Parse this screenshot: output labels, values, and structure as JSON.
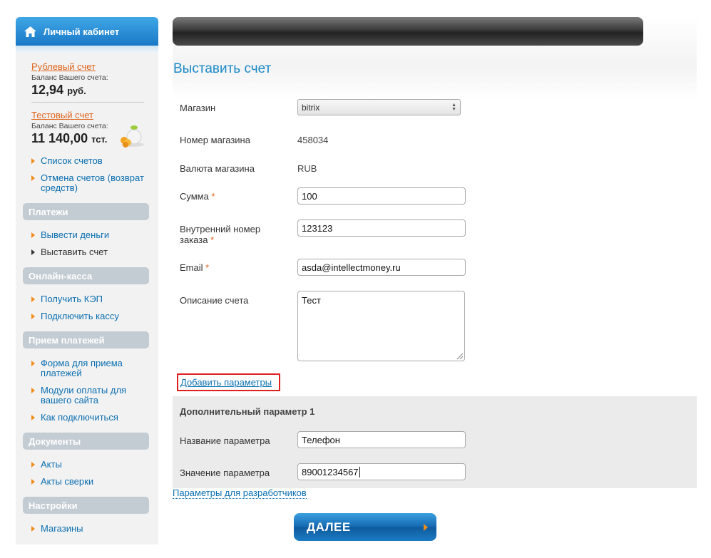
{
  "sidebar": {
    "header": "Личный кабинет",
    "accounts": [
      {
        "link": "Рублевый счет",
        "note": "Баланс Вашего счета:",
        "amount": "12,94",
        "currency": "руб."
      },
      {
        "link": "Тестовый счет",
        "note": "Баланс Вашего счета:",
        "amount": "11 140,00",
        "currency": "тст."
      }
    ],
    "account_links": [
      "Список счетов",
      "Отмена счетов (возврат средств)"
    ],
    "sections": [
      {
        "title": "Платежи",
        "items": [
          "Вывести деньги",
          "Выставить счет"
        ]
      },
      {
        "title": "Онлайн-касса",
        "items": [
          "Получить КЭП",
          "Подключить кассу"
        ]
      },
      {
        "title": "Прием платежей",
        "items": [
          "Форма для приема платежей",
          "Модули оплаты для вашего сайта",
          "Как подключиться"
        ]
      },
      {
        "title": "Документы",
        "items": [
          "Акты",
          "Акты сверки"
        ]
      },
      {
        "title": "Настройки",
        "items": [
          "Магазины"
        ]
      }
    ],
    "active_item": "Выставить счет"
  },
  "main": {
    "title": "Выставить счет",
    "form": {
      "shop_label": "Магазин",
      "shop_value": "bitrix",
      "shop_number_label": "Номер магазина",
      "shop_number_value": "458034",
      "currency_label": "Валюта магазина",
      "currency_value": "RUB",
      "amount_label": "Сумма",
      "amount_value": "100",
      "order_label": "Внутренний номер заказа",
      "order_value": "123123",
      "email_label": "Email",
      "email_value": "asda@intellectmoney.ru",
      "description_label": "Описание счета",
      "description_value": "Тест",
      "required_mark": "*"
    },
    "add_params_link": "Добавить параметры",
    "extra_param": {
      "title": "Дополнительный параметр 1",
      "name_label": "Название параметра",
      "name_value": "Телефон",
      "value_label": "Значение параметра",
      "value_value": "89001234567"
    },
    "dev_link": "Параметры для разработчиков",
    "next_button": "ДАЛЕЕ"
  },
  "colors": {
    "accent_blue": "#1a8ac9",
    "link_blue": "#0b6fb0",
    "orange": "#e0631a",
    "highlight_red": "#e02020"
  }
}
